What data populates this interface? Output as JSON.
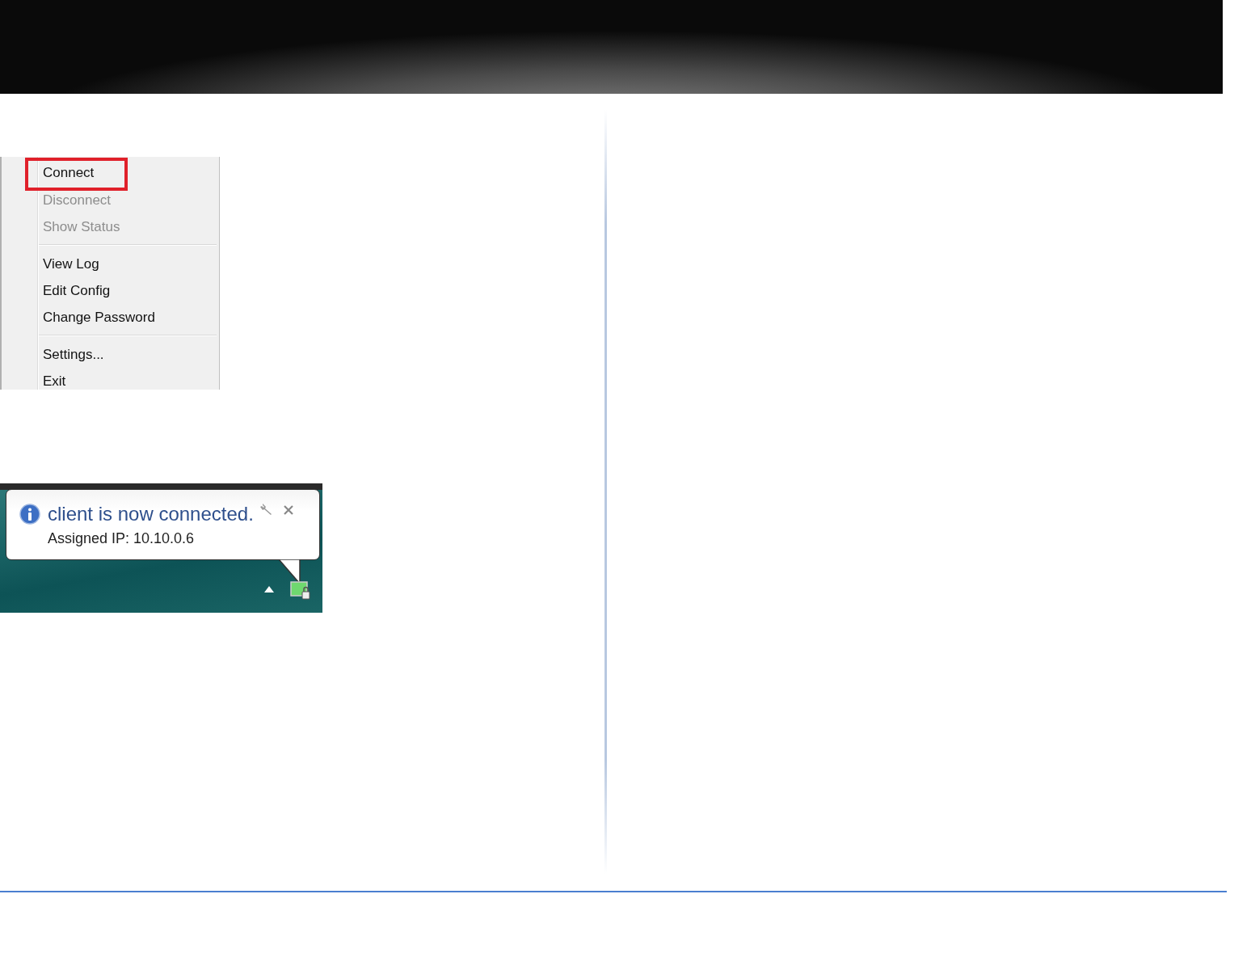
{
  "context_menu": {
    "items": [
      {
        "kind": "item",
        "label": "Connect",
        "disabled": false,
        "highlighted": true
      },
      {
        "kind": "item",
        "label": "Disconnect",
        "disabled": true,
        "highlighted": false
      },
      {
        "kind": "item",
        "label": "Show Status",
        "disabled": true,
        "highlighted": false
      },
      {
        "kind": "separator"
      },
      {
        "kind": "item",
        "label": "View Log",
        "disabled": false,
        "highlighted": false
      },
      {
        "kind": "item",
        "label": "Edit Config",
        "disabled": false,
        "highlighted": false
      },
      {
        "kind": "item",
        "label": "Change Password",
        "disabled": false,
        "highlighted": false
      },
      {
        "kind": "separator"
      },
      {
        "kind": "item",
        "label": "Settings...",
        "disabled": false,
        "highlighted": false
      },
      {
        "kind": "item",
        "label": "Exit",
        "disabled": false,
        "highlighted": false
      }
    ]
  },
  "notification": {
    "title": "client is now connected.",
    "message": "Assigned IP: 10.10.0.6"
  }
}
